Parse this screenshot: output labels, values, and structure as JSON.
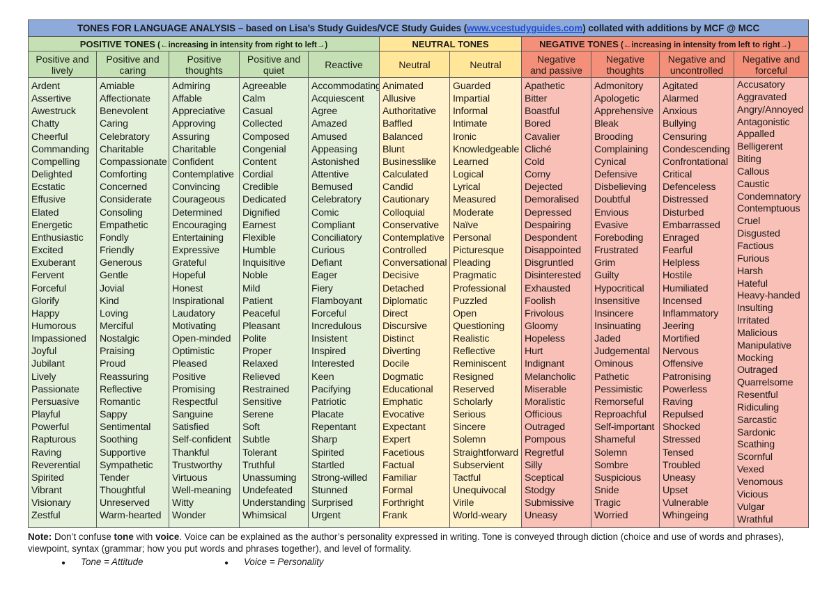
{
  "title": {
    "prefix_bold": "TONES FOR LANGUAGE ANALYSIS",
    "middle": " – based on Lisa’s Study Guides/VCE Study Guides (",
    "link": "www.vcestudyguides.com",
    "suffix": ") collated with additions by MCF @ MCC"
  },
  "groups": {
    "positive": {
      "label": "POSITIVE TONES",
      "sub": " (←increasing in intensity from right to left→)"
    },
    "neutral": {
      "label": "NEUTRAL TONES"
    },
    "negative": {
      "label": "NEGATIVE TONES",
      "sub": " (←increasing in intensity from left to right→)"
    }
  },
  "colors": {
    "title_bg": "#8eaadb",
    "positive_header": "#c5e0b4",
    "positive_body": "#e2efd9",
    "neutral_header": "#ffe699",
    "neutral_body": "#fff2cc",
    "negative_header": "#f4907a",
    "negative_body": "#f8c0b6"
  },
  "columns": [
    {
      "group": "positive",
      "header": [
        "Positive and",
        "lively"
      ],
      "words": [
        "Ardent",
        "Assertive",
        "Awestruck",
        "Chatty",
        "Cheerful",
        "Commanding",
        "Compelling",
        "Delighted",
        "Ecstatic",
        "Effusive",
        "Elated",
        "Energetic",
        "Enthusiastic",
        "Excited",
        "Exuberant",
        "Fervent",
        "Forceful",
        "Glorify",
        "Happy",
        "Humorous",
        "Impassioned",
        "Joyful",
        "Jubilant",
        "Lively",
        "Passionate",
        "Persuasive",
        "Playful",
        "Powerful",
        "Rapturous",
        "Raving",
        "Reverential",
        "Spirited",
        "Vibrant",
        "Visionary",
        "Zestful"
      ]
    },
    {
      "group": "positive",
      "header": [
        "Positive and",
        "caring"
      ],
      "words": [
        "Amiable",
        "Affectionate",
        "Benevolent",
        "Caring",
        "Celebratory",
        "Charitable",
        "Compassionate",
        "Comforting",
        "Concerned",
        "Considerate",
        "Consoling",
        "Empathetic",
        "Fondly",
        "Friendly",
        "Generous",
        "Gentle",
        "Jovial",
        "Kind",
        "Loving",
        "Merciful",
        "Nostalgic",
        "Praising",
        "Proud",
        "Reassuring",
        "Reflective",
        "Romantic",
        "Sappy",
        "Sentimental",
        "Soothing",
        "Supportive",
        "Sympathetic",
        "Tender",
        "Thoughtful",
        "Unreserved",
        "Warm-hearted"
      ]
    },
    {
      "group": "positive",
      "header": [
        "Positive",
        "thoughts"
      ],
      "words": [
        "Admiring",
        "Affable",
        "Appreciative",
        "Approving",
        "Assuring",
        "Charitable",
        "Confident",
        "Contemplative",
        "Convincing",
        "Courageous",
        "Determined",
        "Encouraging",
        "Entertaining",
        "Expressive",
        "Grateful",
        "Hopeful",
        "Honest",
        "Inspirational",
        "Laudatory",
        "Motivating",
        "Open-minded",
        "Optimistic",
        "Pleased",
        "Positive",
        "Promising",
        "Respectful",
        "Sanguine",
        "Satisfied",
        "Self-confident",
        "Thankful",
        "Trustworthy",
        "Virtuous",
        "Well-meaning",
        "Witty",
        "Wonder"
      ]
    },
    {
      "group": "positive",
      "header": [
        "Positive and",
        "quiet"
      ],
      "words": [
        "Agreeable",
        "Calm",
        "Casual",
        "Collected",
        "Composed",
        "Congenial",
        "Content",
        "Cordial",
        "Credible",
        "Dedicated",
        "Dignified",
        "Earnest",
        "Flexible",
        "Humble",
        "Inquisitive",
        "Noble",
        "Mild",
        "Patient",
        "Peaceful",
        "Pleasant",
        "Polite",
        "Proper",
        "Relaxed",
        "Relieved",
        "Restrained",
        "Sensitive",
        "Serene",
        "Soft",
        "Subtle",
        "Tolerant",
        "Truthful",
        "Unassuming",
        "Undefeated",
        "Understanding",
        "Whimsical"
      ]
    },
    {
      "group": "positive",
      "header": [
        "Reactive"
      ],
      "words": [
        "Accommodating",
        "Acquiescent",
        "Agree",
        "Amazed",
        "Amused",
        "Appeasing",
        "Astonished",
        "Attentive",
        "Bemused",
        "Celebratory",
        "Comic",
        "Compliant",
        "Conciliatory",
        "Curious",
        "Defiant",
        "Eager",
        "Fiery",
        "Flamboyant",
        "Forceful",
        "Incredulous",
        "Insistent",
        "Inspired",
        "Interested",
        "Keen",
        "Pacifying",
        "Patriotic",
        "Placate",
        "Repentant",
        "Sharp",
        "Spirited",
        "Startled",
        "Strong-willed",
        "Stunned",
        "Surprised",
        "Urgent"
      ]
    },
    {
      "group": "neutral",
      "header": [
        "Neutral"
      ],
      "words": [
        "Animated",
        "Allusive",
        "Authoritative",
        "Baffled",
        "Balanced",
        "Blunt",
        "Businesslike",
        "Calculated",
        "Candid",
        "Cautionary",
        "Colloquial",
        "Conservative",
        "Contemplative",
        "Controlled",
        "Conversational",
        "Decisive",
        "Detached",
        "Diplomatic",
        "Direct",
        "Discursive",
        "Distinct",
        "Diverting",
        "Docile",
        "Dogmatic",
        "Educational",
        "Emphatic",
        "Evocative",
        "Expectant",
        "Expert",
        "Facetious",
        "Factual",
        "Familiar",
        "Formal",
        "Forthright",
        "Frank"
      ]
    },
    {
      "group": "neutral",
      "header": [
        "Neutral"
      ],
      "words": [
        "Guarded",
        "Impartial",
        "Informal",
        "Intimate",
        "Ironic",
        "Knowledgeable",
        "Learned",
        "Logical",
        "Lyrical",
        "Measured",
        "Moderate",
        "Naïve",
        "Personal",
        "Picturesque",
        "Pleading",
        "Pragmatic",
        "Professional",
        "Puzzled",
        "Open",
        "Questioning",
        "Realistic",
        "Reflective",
        "Reminiscent",
        "Resigned",
        "Reserved",
        "Scholarly",
        "Serious",
        "Sincere",
        "Solemn",
        "Straightforward",
        "Subservient",
        "Tactful",
        "Unequivocal",
        "Virile",
        "World-weary"
      ]
    },
    {
      "group": "negative",
      "header": [
        "Negative",
        "and passive"
      ],
      "words": [
        "Apathetic",
        "Bitter",
        "Boastful",
        "Bored",
        "Cavalier",
        "Cliché",
        "Cold",
        "Corny",
        "Dejected",
        "Demoralised",
        "Depressed",
        "Despairing",
        "Despondent",
        "Disappointed",
        "Disgruntled",
        "Disinterested",
        "Exhausted",
        "Foolish",
        "Frivolous",
        "Gloomy",
        "Hopeless",
        "Hurt",
        "Indignant",
        "Melancholic",
        "Miserable",
        "Moralistic",
        "Officious",
        "Outraged",
        "Pompous",
        "Regretful",
        "Silly",
        "Sceptical",
        "Stodgy",
        "Submissive",
        "Uneasy"
      ]
    },
    {
      "group": "negative",
      "header": [
        "Negative",
        "thoughts"
      ],
      "words": [
        "Admonitory",
        "Apologetic",
        "Apprehensive",
        "Bleak",
        "Brooding",
        "Complaining",
        "Cynical",
        "Defensive",
        "Disbelieving",
        "Doubtful",
        "Envious",
        "Evasive",
        "Foreboding",
        "Frustrated",
        "Grim",
        "Guilty",
        "Hypocritical",
        "Insensitive",
        "Insincere",
        "Insinuating",
        "Jaded",
        "Judgemental",
        "Ominous",
        "Pathetic",
        "Pessimistic",
        "Remorseful",
        "Reproachful",
        "Self-important",
        "Shameful",
        "Solemn",
        "Sombre",
        "Suspicious",
        "Snide",
        "Tragic",
        "Worried"
      ]
    },
    {
      "group": "negative",
      "header": [
        "Negative and",
        "uncontrolled"
      ],
      "words": [
        "Agitated",
        "Alarmed",
        "Anxious",
        "Bullying",
        "Censuring",
        "Condescending",
        "Confrontational",
        "Critical",
        "Defenceless",
        "Distressed",
        "Disturbed",
        "Embarrassed",
        "Enraged",
        "Fearful",
        "Helpless",
        "Hostile",
        "Humiliated",
        "Incensed",
        "Inflammatory",
        "Jeering",
        "Mortified",
        "Nervous",
        "Offensive",
        "Patronising",
        "Powerless",
        "Raving",
        "Repulsed",
        "Shocked",
        "Stressed",
        "Tensed",
        "Troubled",
        "Uneasy",
        "Upset",
        "Vulnerable",
        "Whingeing"
      ]
    },
    {
      "group": "negative",
      "header": [
        "Negative and",
        "forceful"
      ],
      "words": [
        "Accusatory",
        "Aggravated",
        "Angry/Annoyed",
        "Antagonistic",
        "Appalled",
        "Belligerent",
        "Biting",
        "Callous",
        "Caustic",
        "Condemnatory",
        "Contemptuous",
        "Cruel",
        "Disgusted",
        "Factious",
        "Furious",
        "Harsh",
        "Hateful",
        "Heavy-handed",
        "Insulting",
        "Irritated",
        "Malicious",
        "Manipulative",
        "Mocking",
        "Outraged",
        "Quarrelsome",
        "Resentful",
        "Ridiculing",
        "Sarcastic",
        "Sardonic",
        "Scathing",
        "Scornful",
        "Vexed",
        "Venomous",
        "Vicious",
        "Vulgar",
        "Wrathful"
      ]
    }
  ],
  "note": {
    "label": "Note:",
    "t1": " Don’t confuse ",
    "tone": "tone",
    "t2": " with ",
    "voice": "voice",
    "t3": ".  Voice can be explained as the author’s personality expressed in writing.  Tone is conveyed through diction (choice and use of words and phrases), viewpoint, syntax (grammar; how you put words and phrases together), and level of formality."
  },
  "bullets": [
    {
      "text": "Tone = Attitude"
    },
    {
      "text": "Voice = Personality"
    }
  ]
}
